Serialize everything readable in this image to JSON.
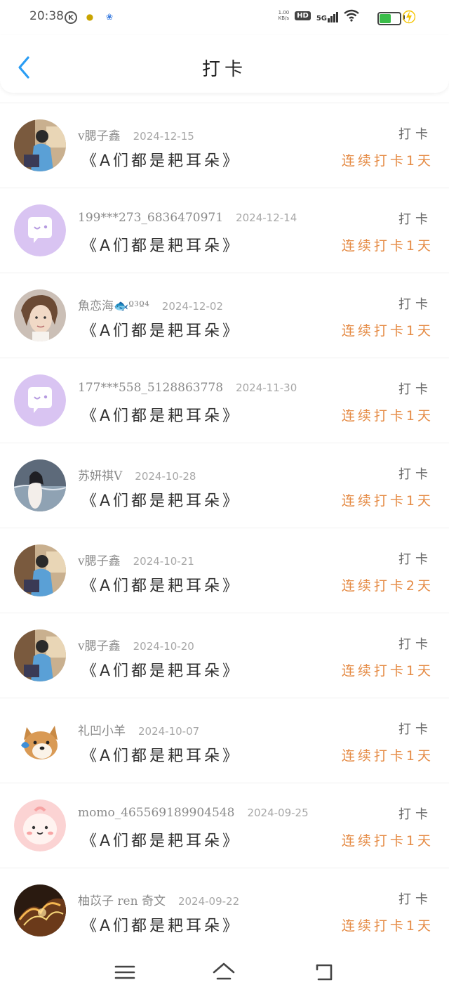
{
  "status_bar": {
    "time": "20:38",
    "net_speed_top": "1.00",
    "net_speed_bottom": "KB/s",
    "hd": "HD",
    "signal": "5G",
    "battery_level": 0.6,
    "battery_color": "#3bbd4a"
  },
  "header": {
    "title": "打卡",
    "back_icon": "chevron-left-icon",
    "back_color": "#2a9df4"
  },
  "items": [
    {
      "name": "v腮子鑫",
      "date": "2024-12-15",
      "book": "《A们都是耙耳朵》",
      "kind": "打卡",
      "streak": "连续打卡1天",
      "avatar": "photo-boy"
    },
    {
      "name": "199***273_6836470971",
      "date": "2024-12-14",
      "book": "《A们都是耙耳朵》",
      "kind": "打卡",
      "streak": "连续打卡1天",
      "avatar": "default-chat"
    },
    {
      "name": "魚恋海🐟º³º⁴",
      "date": "2024-12-02",
      "book": "《A们都是耙耳朵》",
      "kind": "打卡",
      "streak": "连续打卡1天",
      "avatar": "photo-face"
    },
    {
      "name": "177***558_5128863778",
      "date": "2024-11-30",
      "book": "《A们都是耙耳朵》",
      "kind": "打卡",
      "streak": "连续打卡1天",
      "avatar": "default-chat"
    },
    {
      "name": "苏妍祺V",
      "date": "2024-10-28",
      "book": "《A们都是耙耳朵》",
      "kind": "打卡",
      "streak": "连续打卡1天",
      "avatar": "photo-sea"
    },
    {
      "name": "v腮子鑫",
      "date": "2024-10-21",
      "book": "《A们都是耙耳朵》",
      "kind": "打卡",
      "streak": "连续打卡2天",
      "avatar": "photo-boy"
    },
    {
      "name": "v腮子鑫",
      "date": "2024-10-20",
      "book": "《A们都是耙耳朵》",
      "kind": "打卡",
      "streak": "连续打卡1天",
      "avatar": "photo-boy"
    },
    {
      "name": "礼凹小羊",
      "date": "2024-10-07",
      "book": "《A们都是耙耳朵》",
      "kind": "打卡",
      "streak": "连续打卡1天",
      "avatar": "dog"
    },
    {
      "name": "momo_465569189904548",
      "date": "2024-09-25",
      "book": "《A们都是耙耳朵》",
      "kind": "打卡",
      "streak": "连续打卡1天",
      "avatar": "pink-blob"
    },
    {
      "name": "柚苡子 ren 奇文",
      "date": "2024-09-22",
      "book": "《A们都是耙耳朵》",
      "kind": "打卡",
      "streak": "连续打卡1天",
      "avatar": "photo-fire"
    }
  ],
  "nav": {
    "menu_icon": "menu-icon",
    "home_icon": "home-icon",
    "back_icon": "back-icon"
  }
}
